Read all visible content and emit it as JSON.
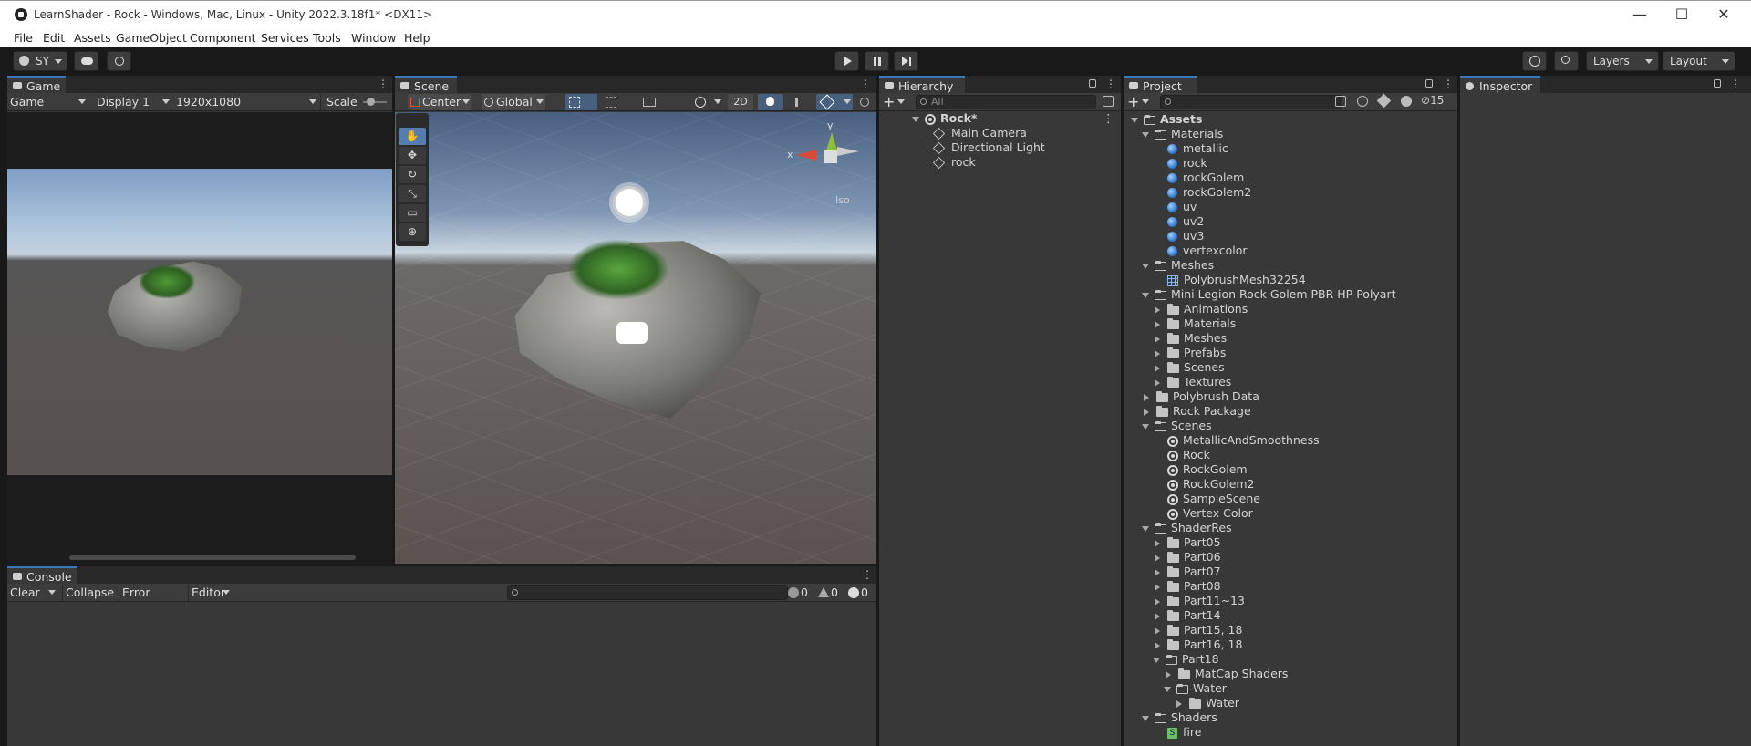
{
  "window": {
    "title": "LearnShader - Rock - Windows, Mac, Linux - Unity 2022.3.18f1* <DX11>",
    "controls": [
      "—",
      "☐",
      "✕"
    ]
  },
  "menu": [
    "File",
    "Edit",
    "Assets",
    "GameObject",
    "Component",
    "Services",
    "Tools",
    "Window",
    "Help"
  ],
  "toolbar": {
    "account": "SY",
    "layers_label": "Layers",
    "layout_label": "Layout"
  },
  "game": {
    "tab": "Game",
    "mode": "Game",
    "display": "Display 1",
    "resolution": "1920x1080",
    "scale_label": "Scale"
  },
  "scene": {
    "tab": "Scene",
    "pivot": "Center",
    "space": "Global",
    "mode_2d": "2D",
    "gizmo_x": "x",
    "gizmo_y": "y",
    "projection": "Iso"
  },
  "hierarchy": {
    "tab": "Hierarchy",
    "search_placeholder": "All",
    "scene_name": "Rock*",
    "items": [
      "Main Camera",
      "Directional Light",
      "rock"
    ]
  },
  "project": {
    "tab": "Project",
    "hidden_count": "15",
    "root": "Assets",
    "materials_folder": "Materials",
    "materials": [
      "metallic",
      "rock",
      "rockGolem",
      "rockGolem2",
      "uv",
      "uv2",
      "uv3",
      "vertexcolor"
    ],
    "meshes_folder": "Meshes",
    "meshes": [
      "PolybrushMesh32254"
    ],
    "golem_folder": "Mini Legion Rock Golem PBR HP Polyart",
    "golem_children": [
      "Animations",
      "Materials",
      "Meshes",
      "Prefabs",
      "Scenes",
      "Textures"
    ],
    "polybrush": "Polybrush Data",
    "rock_package": "Rock Package",
    "scenes_folder": "Scenes",
    "scenes": [
      "MetallicAndSmoothness",
      "Rock",
      "RockGolem",
      "RockGolem2",
      "SampleScene",
      "Vertex Color"
    ],
    "shaderres_folder": "ShaderRes",
    "shaderres_children": [
      "Part05",
      "Part06",
      "Part07",
      "Part08",
      "Part11~13",
      "Part14",
      "Part15, 18",
      "Part16, 18"
    ],
    "part18": "Part18",
    "matcap": "MatCap Shaders",
    "water": "Water",
    "water_child": "Water",
    "shaders_folder": "Shaders",
    "shaders": [
      "fire"
    ]
  },
  "inspector": {
    "tab": "Inspector"
  },
  "console": {
    "tab": "Console",
    "clear": "Clear",
    "collapse": "Collapse",
    "error_pause": "Error Pause",
    "editor": "Editor",
    "info_count": "0",
    "warn_count": "0",
    "error_count": "0"
  }
}
